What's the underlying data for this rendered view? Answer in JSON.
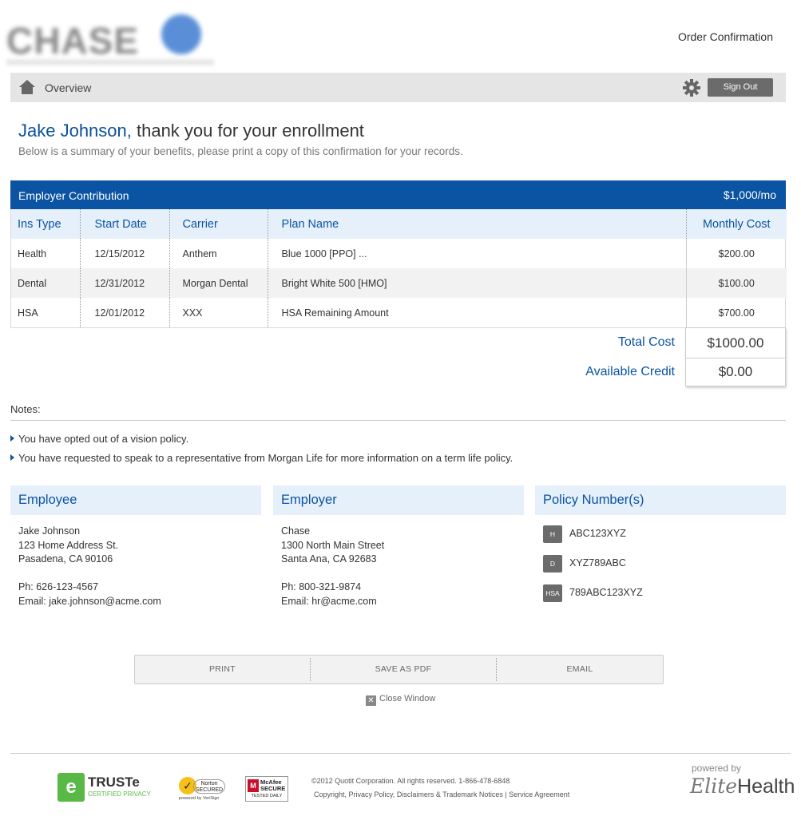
{
  "header": {
    "page_title": "Order Confirmation"
  },
  "nav": {
    "overview_label": "Overview",
    "signout_label": "Sign Out"
  },
  "welcome": {
    "name": "Jake Johnson,",
    "message": " thank you for your enrollment",
    "subtitle": "Below is a summary of your benefits, please print a copy of this confirmation for your records."
  },
  "contribution": {
    "label": "Employer Contribution",
    "value": "$1,000/mo"
  },
  "plans": {
    "headers": [
      "Ins Type",
      "Start Date",
      "Carrier",
      "Plan Name",
      "Monthly Cost"
    ],
    "rows": [
      [
        "Health",
        "12/15/2012",
        "Anthem",
        "Blue 1000 [PPO] ...",
        "$200.00"
      ],
      [
        "Dental",
        "12/31/2012",
        "Morgan Dental",
        "Bright White 500 [HMO]",
        "$100.00"
      ],
      [
        "HSA",
        "12/01/2012",
        "XXX",
        "HSA Remaining Amount",
        "$700.00"
      ]
    ]
  },
  "totals": {
    "total_label": "Total Cost",
    "total_value": "$1000.00",
    "credit_label": "Available Credit",
    "credit_value": "$0.00"
  },
  "notes": {
    "label": "Notes:",
    "items": [
      "You have opted out of a vision policy.",
      "You have requested to speak to a representative from Morgan Life for more information on a term life policy."
    ]
  },
  "employee": {
    "heading": "Employee",
    "name": "Jake Johnson",
    "address1": "123 Home Address St.",
    "address2": "Pasadena, CA 90106",
    "phone": "Ph: 626-123-4567",
    "email": "Email: jake.johnson@acme.com"
  },
  "employer": {
    "heading": "Employer",
    "name": "Chase",
    "address1": "1300 North Main Street",
    "address2": "Santa Ana, CA 92683",
    "phone": "Ph: 800-321-9874",
    "email": "Email: hr@acme.com"
  },
  "policies": {
    "heading": "Policy Number(s)",
    "items": [
      {
        "badge": "H",
        "number": "ABC123XYZ"
      },
      {
        "badge": "D",
        "number": "XYZ789ABC"
      },
      {
        "badge": "HSA",
        "number": "789ABC123XYZ"
      }
    ]
  },
  "actions": {
    "print": "PRINT",
    "save_pdf": "SAVE AS PDF",
    "email": "EMAIL",
    "close": "Close Window",
    "close_glyph": "✕"
  },
  "footer": {
    "truste_glyph": "e",
    "truste_name": "TRUSTe",
    "truste_sub": "CERTIFIED PRIVACY",
    "norton_glyph": "✓",
    "norton_line1": "Norton",
    "norton_line2": "SECURED",
    "norton_sub": "powered by VeriSign",
    "mcafee_glyph": "M",
    "mcafee_line1": "McAfee",
    "mcafee_line2": "SECURE",
    "mcafee_sub": "TESTED DAILY",
    "copyright": "©2012 Quotit Corporation. All rights reserved. 1-866-478-6848",
    "links": [
      "Copyright, Privacy Policy, Disclaimers & Trademark Notices",
      "Service Agreement"
    ],
    "link_sep": " | ",
    "powered_by": "powered by",
    "brand_italic": "Elite",
    "brand_plain": "Health"
  },
  "colors": {
    "brand_blue": "#0b53a3",
    "header_tint": "#e6f0fa",
    "badge_gray": "#6b6b6b"
  }
}
